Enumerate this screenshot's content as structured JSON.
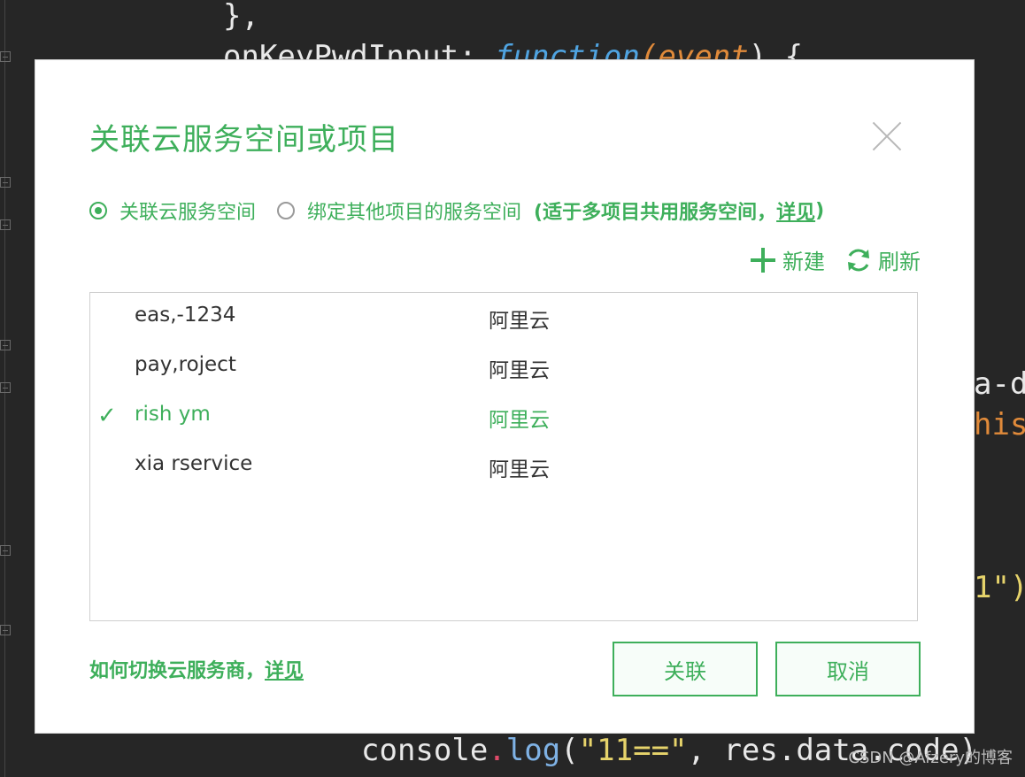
{
  "editor": {
    "lines": {
      "close_brace": "},",
      "key_prop": "onKeyPwdInput:",
      "key_fn": "function",
      "key_arg": "event",
      "key_tail": ") {",
      "right_a": "a-d",
      "right_b": "his",
      "right_c": "1\")",
      "console_obj": "console",
      "console_dot": ".",
      "console_method": "log",
      "console_open": "(",
      "console_str": "\"11==\"",
      "console_rest": ", res.data.code)"
    }
  },
  "watermark": "CSDN @Afzery的博客",
  "dialog": {
    "title": "关联云服务空间或项目",
    "radio_options": [
      {
        "label": "关联云服务空间",
        "selected": true
      },
      {
        "label": "绑定其他项目的服务空间",
        "selected": false
      }
    ],
    "hint_prefix": "(适于多项目共用服务空间，",
    "hint_link": "详见",
    "hint_suffix": ")",
    "actions": {
      "new_label": "新建",
      "refresh_label": "刷新"
    },
    "spaces": [
      {
        "name": "eas,-1234",
        "provider": "阿里云",
        "selected": false
      },
      {
        "name": "pay,roject",
        "provider": "阿里云",
        "selected": false
      },
      {
        "name": "rish   ym",
        "provider": "阿里云",
        "selected": true
      },
      {
        "name": "xia  rservice",
        "provider": "阿里云",
        "selected": false
      }
    ],
    "footer_text": "如何切换云服务商，",
    "footer_link": "详见",
    "ok_label": "关联",
    "cancel_label": "取消"
  },
  "colors": {
    "accent": "#3eaf5b",
    "background": "#262626"
  }
}
